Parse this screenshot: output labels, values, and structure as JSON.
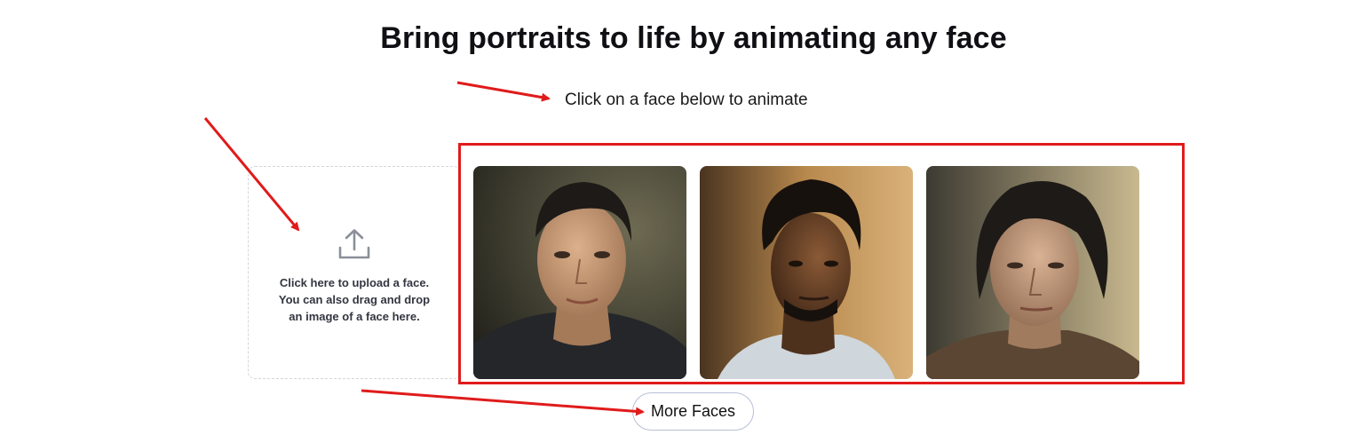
{
  "header": {
    "title": "Bring portraits to life by animating any face"
  },
  "instruction": "Click on a face below to animate",
  "upload": {
    "icon": "upload-icon",
    "lines": [
      "Click here to upload a face.",
      "You can also drag and drop",
      "an image of a face here."
    ]
  },
  "faces": [
    {
      "name": "face-1",
      "background": "#3b3b2f",
      "skin": "#c99a74",
      "hair": "#1d1a17",
      "shirt": "#24262a"
    },
    {
      "name": "face-2",
      "background": "#7a5a30",
      "skin": "#6a4327",
      "hair": "#17110d",
      "shirt": "#cfd6dc"
    },
    {
      "name": "face-3",
      "background": "#5c5a4a",
      "skin": "#c29a7b",
      "hair": "#1e1a17",
      "shirt": "#5b4633"
    }
  ],
  "more_faces_label": "More Faces",
  "colors": {
    "annotation_red": "#e01b1b",
    "button_border": "#b8bfd6",
    "upload_border": "#d4d6dc"
  }
}
